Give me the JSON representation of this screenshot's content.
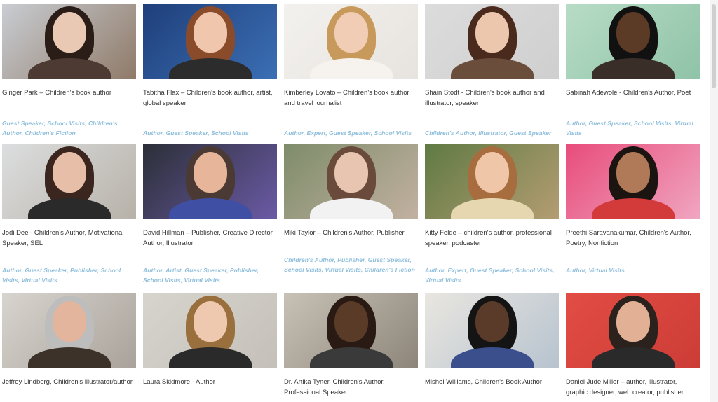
{
  "people": [
    {
      "name": "Ginger Park – Children's book author",
      "tags": [
        "Guest Speaker",
        "School Visits",
        "Children's Author",
        "Children's Fiction"
      ],
      "colors": {
        "c1": "#c9cdd3",
        "c2": "#8f7a68",
        "skin": "#e9c9b4",
        "hair": "#2a1d18",
        "shirt": "#4d3b33"
      }
    },
    {
      "name": "Tabitha Flax – Children's book author, artist, global speaker",
      "tags": [
        "Author",
        "Guest Speaker",
        "School Visits"
      ],
      "colors": {
        "c1": "#1f3f7a",
        "c2": "#3b6fb5",
        "skin": "#f0c6ad",
        "hair": "#8a4b2a",
        "shirt": "#2c2c2c"
      }
    },
    {
      "name": "Kimberley Lovato – Children's book author and travel journalist",
      "tags": [
        "Author",
        "Expert",
        "Guest Speaker",
        "School Visits"
      ],
      "colors": {
        "c1": "#f3f1ee",
        "c2": "#e7e3de",
        "skin": "#f1cdb5",
        "hair": "#c79a5b",
        "shirt": "#f6f3ef"
      }
    },
    {
      "name": "Shain Stodt - Children's book author and illustrator, speaker",
      "tags": [
        "Children's Author",
        "Illustrator",
        "Guest Speaker"
      ],
      "colors": {
        "c1": "#dcdcdc",
        "c2": "#cfcfcf",
        "skin": "#edc6ae",
        "hair": "#4a2a1d",
        "shirt": "#6b4d3b"
      }
    },
    {
      "name": "Sabinah Adewole - Children's Author, Poet",
      "tags": [
        "Author",
        "Guest Speaker",
        "School Visits",
        "Virtual Visits"
      ],
      "colors": {
        "c1": "#b8dcc6",
        "c2": "#8fc3a8",
        "skin": "#5b3a26",
        "hair": "#111111",
        "shirt": "#3a2e29"
      }
    },
    {
      "name": "Jodi Dee - Children's Author, Motivational Speaker, SEL",
      "tags": [
        "Author",
        "Guest Speaker",
        "Publisher",
        "School Visits",
        "Virtual Visits"
      ],
      "colors": {
        "c1": "#dcdedf",
        "c2": "#b7b1a8",
        "skin": "#e7bfa8",
        "hair": "#3a261e",
        "shirt": "#2a2a2a"
      }
    },
    {
      "name": "David Hillman – Publisher, Creative Director, Author, Illustrator",
      "tags": [
        "Author",
        "Artist",
        "Guest Speaker",
        "Publisher",
        "School Visits",
        "Virtual Visits"
      ],
      "colors": {
        "c1": "#2b2f37",
        "c2": "#6b5aa6",
        "skin": "#e6b59a",
        "hair": "#4b3a33",
        "shirt": "#3f4fa3"
      }
    },
    {
      "name": "Miki Taylor – Children's Author, Publisher",
      "tags": [
        "Children's Author",
        "Publisher",
        "Guest Speaker",
        "School Visits",
        "Virtual Visits",
        "Children's Fiction"
      ],
      "colors": {
        "c1": "#7e8c6a",
        "c2": "#c2b1a1",
        "skin": "#e7c5b0",
        "hair": "#6a4b3b",
        "shirt": "#f2f2f2"
      }
    },
    {
      "name": "Kitty Felde – children's author, professional speaker, podcaster",
      "tags": [
        "Author",
        "Expert",
        "Guest Speaker",
        "School Visits",
        "Virtual Visits"
      ],
      "colors": {
        "c1": "#5f7a44",
        "c2": "#b49d72",
        "skin": "#efc7a8",
        "hair": "#a76d3e",
        "shirt": "#e6d7b1"
      }
    },
    {
      "name": "Preethi Saravanakumar, Children's Author, Poetry, Nonfiction",
      "tags": [
        "Author",
        "Virtual Visits"
      ],
      "colors": {
        "c1": "#e84c7b",
        "c2": "#f0a6c1",
        "skin": "#b07a58",
        "hair": "#1b1411",
        "shirt": "#d33a3a"
      }
    },
    {
      "name": "Jeffrey Lindberg, Children's illustrator/author",
      "tags": [],
      "colors": {
        "c1": "#d8d4cf",
        "c2": "#a9a29a",
        "skin": "#e2b59c",
        "hair": "#bdbdbd",
        "shirt": "#3d3229"
      }
    },
    {
      "name": "Laura Skidmore - Author",
      "tags": [],
      "colors": {
        "c1": "#d7d4ce",
        "c2": "#c4c0b9",
        "skin": "#efc8b0",
        "hair": "#9a6f3e",
        "shirt": "#2a2a2a"
      }
    },
    {
      "name": "Dr. Artika Tyner, Children's Author, Professional Speaker",
      "tags": [],
      "colors": {
        "c1": "#c8c2b6",
        "c2": "#8d857a",
        "skin": "#5a3b28",
        "hair": "#2a1a14",
        "shirt": "#3a3a3a"
      }
    },
    {
      "name": "Mishel Williams, Children's Book Author",
      "tags": [],
      "colors": {
        "c1": "#e9e6e0",
        "c2": "#b7c3cf",
        "skin": "#5a3a28",
        "hair": "#141414",
        "shirt": "#3b4f8d"
      }
    },
    {
      "name": "Daniel Jude Miller – author, illustrator, graphic designer, web creator, publisher",
      "tags": [],
      "colors": {
        "c1": "#e24d44",
        "c2": "#cc3c36",
        "skin": "#e1b095",
        "hair": "#2b211d",
        "shirt": "#2a2a2a"
      }
    }
  ]
}
